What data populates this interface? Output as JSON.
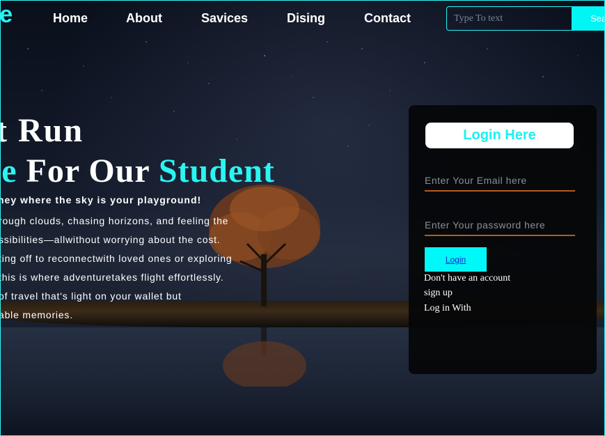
{
  "header": {
    "logo": "re",
    "nav": [
      "Home",
      "About",
      "Savices",
      "Dising",
      "Contact"
    ],
    "search_placeholder": "Type To text",
    "search_button": "Sea"
  },
  "hero": {
    "line1": "t Run",
    "line2_accent": "ee",
    "line2_mid": " For Our ",
    "line2_accent2": "Student",
    "subtitle": "ney where the sky is your playground!",
    "paragraph": [
      "rough clouds, chasing horizons, and feeling the",
      "ssibilities—allwithout worrying about the cost.",
      "ting off to reconnectwith loved ones or exploring",
      "this is where adventuretakes flight effortlessly.",
      "of travel that's light on your wallet but",
      "able memories."
    ]
  },
  "login": {
    "title": "Login Here",
    "email_placeholder": "Enter Your Email here",
    "password_placeholder": "Enter Your password here",
    "button": "Login",
    "no_account": "Don't have an account",
    "signup": "sign up",
    "login_with": "Log in With"
  },
  "colors": {
    "accent": "#00f5f5",
    "field_underline": "#b85a20"
  }
}
